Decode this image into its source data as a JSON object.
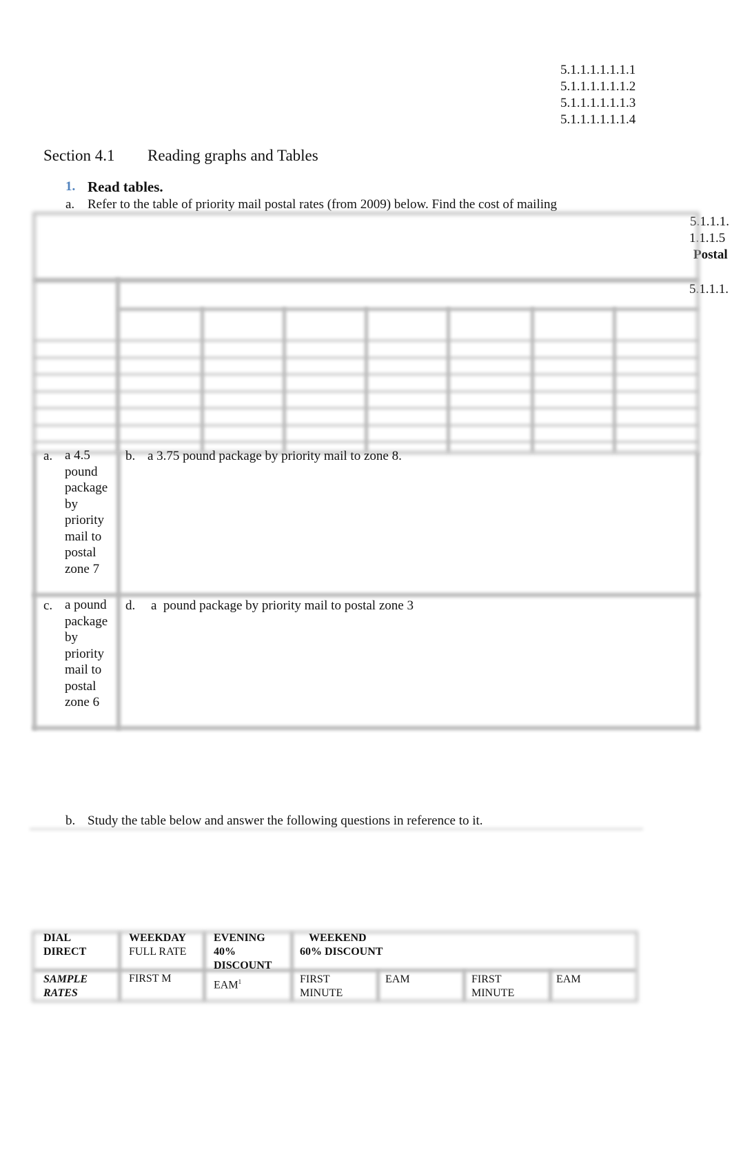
{
  "outline_numbers": [
    "5.1.1.1.1.1.1.1",
    "5.1.1.1.1.1.1.2",
    "5.1.1.1.1.1.1.3",
    "5.1.1.1.1.1.1.4"
  ],
  "section": {
    "number": "Section 4.1",
    "title": "Reading graphs and Tables"
  },
  "item1": {
    "number": "1.",
    "title": "Read tables."
  },
  "part_a": {
    "label": "a.",
    "text": "Refer to the table of priority mail postal rates (from 2009) below. Find the cost of mailing"
  },
  "margin_text": {
    "line1": "5.1.1.1.",
    "line2": "1.1.1.5",
    "line3": "Postal",
    "line4": "5.1.1.1."
  },
  "questions": [
    {
      "label": "a.",
      "text": "a 4.5 pound package by priority mail to postal zone 7"
    },
    {
      "label": "b.",
      "text": "a 3.75 pound package by priority mail to zone 8."
    },
    {
      "label": "c.",
      "text": "a pound package by priority mail to postal zone 6"
    },
    {
      "label": "d.",
      "text": "a  pound package by priority mail to postal zone 3"
    }
  ],
  "part_b": {
    "label": "b.",
    "text": "Study the table below and answer the following questions in reference to it."
  },
  "rates_table": {
    "header": {
      "dial_direct": "DIAL DIRECT",
      "weekday": "WEEKDAY",
      "weekday_sub": "FULL RATE",
      "evening": "EVENING 40% DISCOUNT",
      "weekend": "WEEKEND",
      "weekend_sub": "60% DISCOUNT"
    },
    "row": {
      "label": "SAMPLE RATES",
      "cells": [
        "FIRST M",
        "EAM",
        "FIRST MINUTE",
        "EAM",
        "FIRST MINUTE",
        "EAM"
      ],
      "footnote": "1"
    }
  }
}
